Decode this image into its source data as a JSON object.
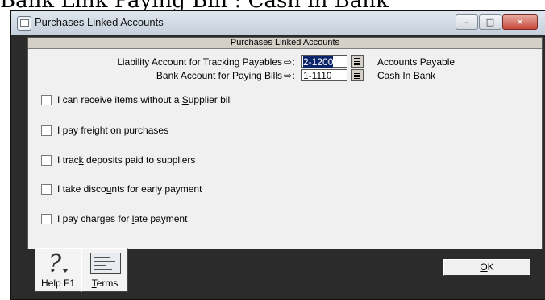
{
  "page": {
    "top_caption": "Bank Link Paying Bill : Cash in Bank"
  },
  "window": {
    "title": "Purchases Linked Accounts",
    "controls": {
      "minimize": "–",
      "maximize": "□",
      "close": "✕"
    }
  },
  "panel": {
    "header": "Purchases Linked Accounts",
    "rows": [
      {
        "label": "Liability Account for Tracking Payables",
        "arrow": "⇨:",
        "account": "2-1200",
        "account_name": "Accounts Payable",
        "selected": true
      },
      {
        "label": "Bank Account for Paying Bills",
        "arrow": "⇨:",
        "account": "1-1110",
        "account_name": "Cash In Bank",
        "selected": false
      }
    ],
    "checkboxes": [
      {
        "pre": "I can receive items without a ",
        "key": "S",
        "post": "upplier bill",
        "checked": false
      },
      {
        "pre": "I pay freight on purchases",
        "key": "",
        "post": "",
        "checked": false
      },
      {
        "pre": "I trac",
        "key": "k",
        "post": " deposits paid to suppliers",
        "checked": false
      },
      {
        "pre": "I take disco",
        "key": "u",
        "post": "nts for early payment",
        "checked": false
      },
      {
        "pre": "I pay charges for ",
        "key": "l",
        "post": "ate payment",
        "checked": false
      }
    ]
  },
  "footer": {
    "help": {
      "label": "Help F1",
      "icon": "help-icon"
    },
    "terms": {
      "key": "T",
      "rest": "erms",
      "icon": "terms-card-icon"
    },
    "ok": {
      "key": "O",
      "rest": "K"
    }
  }
}
